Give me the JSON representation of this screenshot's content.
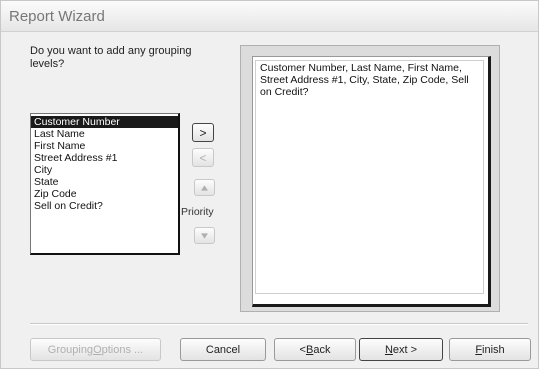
{
  "window": {
    "title": "Report Wizard"
  },
  "prompt": "Do you want to add any grouping levels?",
  "fields": [
    {
      "label": "Customer Number",
      "selected": true
    },
    {
      "label": "Last Name",
      "selected": false
    },
    {
      "label": "First Name",
      "selected": false
    },
    {
      "label": "Street Address #1",
      "selected": false
    },
    {
      "label": "City",
      "selected": false
    },
    {
      "label": "State",
      "selected": false
    },
    {
      "label": "Zip Code",
      "selected": false
    },
    {
      "label": "Sell on Credit?",
      "selected": false
    }
  ],
  "controls": {
    "add_label": ">",
    "remove_label": "<",
    "priority_label": "Priority",
    "up_icon": "triangle-up-icon",
    "down_icon": "triangle-down-icon"
  },
  "preview": {
    "text": "Customer Number, Last Name, First Name, Street Address #1, City, State, Zip Code, Sell on Credit?"
  },
  "buttons": {
    "grouping_options": {
      "pre": "Grouping ",
      "accel": "O",
      "post": "ptions ..."
    },
    "cancel": {
      "pre": "Cancel",
      "accel": "",
      "post": ""
    },
    "back": {
      "pre": "< ",
      "accel": "B",
      "post": "ack"
    },
    "next": {
      "pre": "",
      "accel": "N",
      "post": "ext >"
    },
    "finish": {
      "pre": "",
      "accel": "F",
      "post": "inish"
    }
  },
  "colors": {
    "selection": "#1a1a1a",
    "dialog_bg": "#f0f0f0"
  }
}
